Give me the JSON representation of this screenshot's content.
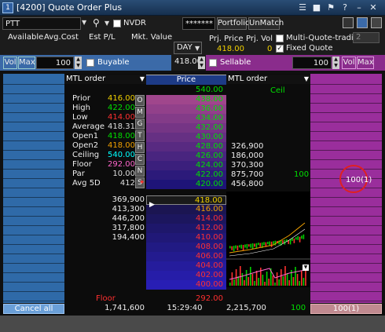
{
  "window": {
    "id": "[4200]",
    "title": "Quote Order Plus"
  },
  "toolbar": {
    "symbol": "PTT",
    "nvdr_label": "NVDR",
    "password": "*******",
    "portfolio_btn": "Portfolio",
    "unmatch_btn": "UnMatch"
  },
  "header": {
    "available": "Available",
    "avg_cost": "Avg.Cost",
    "est_pl": "Est P/L",
    "mkt_value": "Mkt. Value",
    "prj_price_label": "Prj. Price",
    "prj_vol_label": "Prj. Vol",
    "prj_price": "418.00",
    "prj_vol": "0",
    "multi_quote": "Multi-Quote-trading",
    "multi_count": "2",
    "fixed_quote": "Fixed Quote",
    "validity": "DAY"
  },
  "buy_strip": {
    "vol": "Vol",
    "max": "Max",
    "qty": "100",
    "buyable": "Buyable",
    "price": "418.00"
  },
  "sell_strip": {
    "sellable": "Sellable",
    "qty": "100",
    "vol": "Vol",
    "max": "Max"
  },
  "left_mode": "MTL order",
  "right_mode": "MTL order",
  "price_header": "Price",
  "ceil_label": "Ceil",
  "floor_label": "Floor",
  "stats": [
    {
      "k": "Prior",
      "v": "416.00",
      "c": "#f0d000"
    },
    {
      "k": "High",
      "v": "422.00",
      "c": "#00e000"
    },
    {
      "k": "Low",
      "v": "414.00",
      "c": "#ff3030"
    },
    {
      "k": "Average",
      "v": "418.31",
      "c": "#dddddd"
    },
    {
      "k": "Open1",
      "v": "418.00",
      "c": "#00e000"
    },
    {
      "k": "Open2",
      "v": "418.00",
      "c": "#f0a000"
    },
    {
      "k": "Ceiling",
      "v": "540.00",
      "c": "#00ffff"
    },
    {
      "k": "Floor",
      "v": "292.00",
      "c": "#ff66cc"
    },
    {
      "k": "Par",
      "v": "10.00",
      "c": "#dddddd"
    },
    {
      "k": "Avg 5D",
      "v": "412",
      "c": "#dddddd"
    }
  ],
  "stat_tabs": [
    "O",
    "M",
    "G",
    "T",
    "H",
    "C",
    "N",
    "S"
  ],
  "ceil_price": "540.00",
  "ask_prices": [
    "438.00",
    "436.00",
    "434.00",
    "432.00",
    "430.00",
    "428.00",
    "426.00",
    "424.00",
    "422.00",
    "420.00"
  ],
  "ask_vols": [
    "",
    "",
    "",
    "",
    "",
    "326,900",
    "186,000",
    "370,300",
    "875,700",
    "456,800"
  ],
  "ask_100_index": 8,
  "ask_100": "100",
  "bid_prices": [
    "418.00",
    "416.00",
    "414.00",
    "412.00",
    "410.00",
    "408.00",
    "406.00",
    "404.00",
    "402.00",
    "400.00"
  ],
  "bid_vols": [
    "369,900",
    "413,300",
    "446,200",
    "317,800",
    "194,400",
    "",
    "",
    "",
    "",
    ""
  ],
  "floor_price": "292.00",
  "right_order": "100(1)",
  "bottom": {
    "cancel_all": "Cancel all",
    "bid_total": "1,741,600",
    "time": "15:29:40",
    "ask_total": "2,215,700",
    "my_vol": "100",
    "my_order": "100(1)"
  }
}
